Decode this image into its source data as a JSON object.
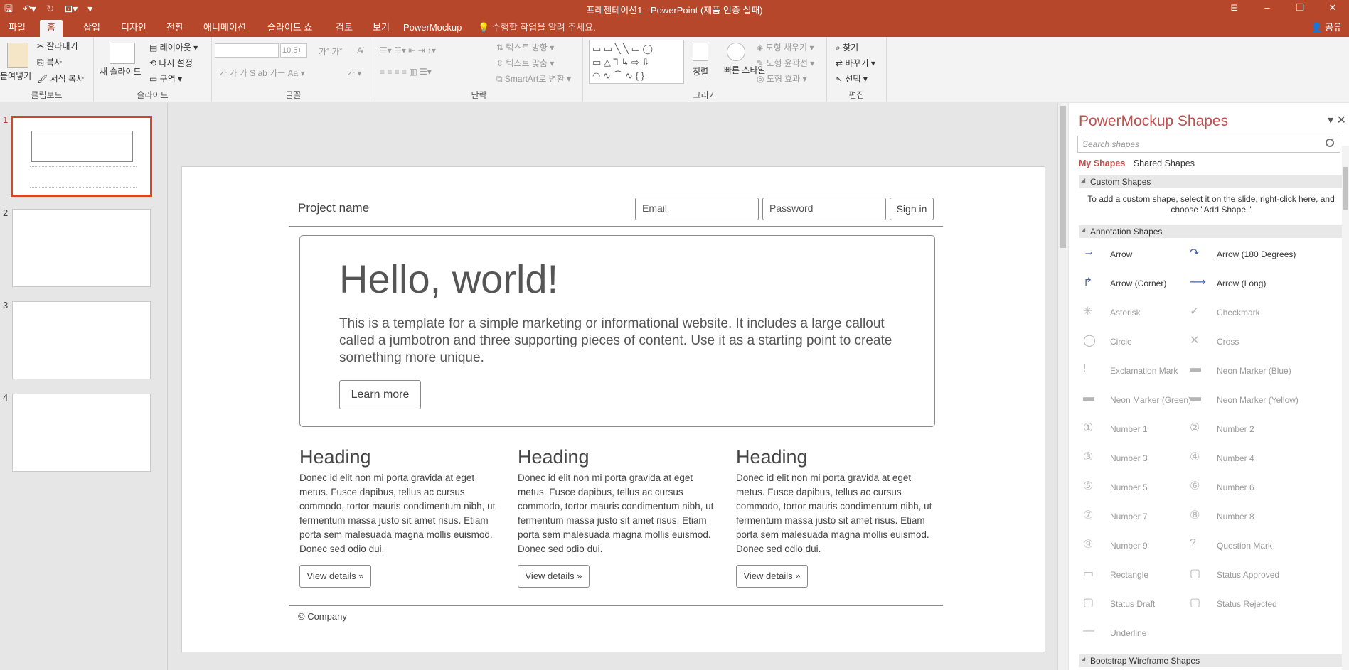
{
  "titlebar": {
    "title": "프레젠테이션1 - PowerPoint (제품 인증 실패)",
    "qat": [
      "save-icon",
      "undo-icon",
      "redo-icon",
      "present-icon",
      "customize-icon"
    ],
    "controls": [
      "ribbon-display-icon",
      "minimize-icon",
      "restore-icon",
      "close-icon"
    ]
  },
  "tabs": {
    "items": [
      "파일",
      "홈",
      "삽입",
      "디자인",
      "전환",
      "애니메이션",
      "슬라이드 쇼",
      "검토",
      "보기",
      "PowerMockup"
    ],
    "active": "홈",
    "tellme": "수행할 작업을 알려 주세요.",
    "share": "공유"
  },
  "ribbon": {
    "clipboard": {
      "label": "클립보드",
      "paste": "붙여넣기",
      "cut": "잘라내기",
      "copy": "복사",
      "format_painter": "서식 복사"
    },
    "slides": {
      "label": "슬라이드",
      "new_slide": "새 슬라이드",
      "layout": "레이아웃",
      "reset": "다시 설정",
      "section": "구역"
    },
    "font": {
      "label": "글꼴",
      "size": "10.5+"
    },
    "paragraph": {
      "label": "단락",
      "text_direction": "텍스트 방향",
      "align_text": "텍스트 맞춤",
      "smartart": "SmartArt로 변환"
    },
    "drawing": {
      "label": "그리기",
      "arrange": "정렬",
      "quick_styles": "빠른 스타일",
      "fill": "도형 채우기",
      "outline": "도형 윤곽선",
      "effects": "도형 효과"
    },
    "editing": {
      "label": "편집",
      "find": "찾기",
      "replace": "바꾸기",
      "select": "선택"
    }
  },
  "thumbnails": {
    "numbers": [
      "1",
      "2",
      "3",
      "4"
    ],
    "selected": "1"
  },
  "slide": {
    "project_name": "Project name",
    "email_placeholder": "Email",
    "password_placeholder": "Password",
    "signin": "Sign in",
    "hello": "Hello, world!",
    "lead": "This is a template for a simple marketing or informational website. It includes a large callout called a jumbotron and three supporting pieces of content. Use it as a starting point to create something more unique.",
    "learn_more": "Learn more",
    "columns": [
      {
        "heading": "Heading",
        "body": "Donec id elit non mi porta gravida at eget metus. Fusce dapibus, tellus ac cursus commodo, tortor mauris condimentum nibh, ut fermentum massa justo sit amet risus. Etiam porta sem malesuada magna mollis euismod. Donec sed odio dui.",
        "button": "View details »"
      },
      {
        "heading": "Heading",
        "body": "Donec id elit non mi porta gravida at eget metus. Fusce dapibus, tellus ac cursus commodo, tortor mauris condimentum nibh, ut fermentum massa justo sit amet risus. Etiam porta sem malesuada magna mollis euismod. Donec sed odio dui.",
        "button": "View details »"
      },
      {
        "heading": "Heading",
        "body": "Donec id elit non mi porta gravida at eget metus. Fusce dapibus, tellus ac cursus commodo, tortor mauris condimentum nibh, ut fermentum massa justo sit amet risus. Etiam porta sem malesuada magna mollis euismod. Donec sed odio dui.",
        "button": "View details »"
      }
    ],
    "footer": "© Company"
  },
  "pane": {
    "title": "PowerMockup Shapes",
    "search_placeholder": "Search shapes",
    "tab_my": "My Shapes",
    "tab_shared": "Shared Shapes",
    "section_custom": "Custom Shapes",
    "custom_help": "To add a custom shape, select it on the slide, right-click here, and choose \"Add Shape.\"",
    "section_annotation": "Annotation Shapes",
    "section_bootstrap": "Bootstrap Wireframe Shapes",
    "shapes": [
      "Arrow",
      "Arrow (180 Degrees)",
      "Arrow (Corner)",
      "Arrow (Long)",
      "Asterisk",
      "Checkmark",
      "Circle",
      "Cross",
      "Exclamation Mark",
      "Neon Marker (Blue)",
      "Neon Marker (Green)",
      "Neon Marker (Yellow)",
      "Number 1",
      "Number 2",
      "Number 3",
      "Number 4",
      "Number 5",
      "Number 6",
      "Number 7",
      "Number 8",
      "Number 9",
      "Question Mark",
      "Rectangle",
      "Status Approved",
      "Status Draft",
      "Status Rejected",
      "Underline"
    ]
  },
  "colors": {
    "accent": "#b7472a",
    "pane_title": "#c0504d"
  }
}
